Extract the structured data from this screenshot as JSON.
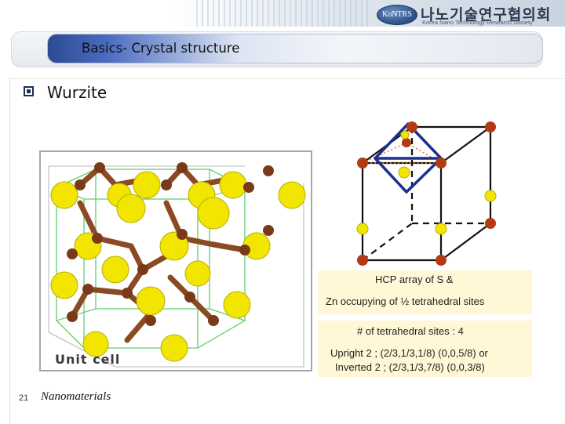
{
  "header": {
    "logo_abbr": "KoNTRS",
    "logo_korean": "나노기술연구협의회",
    "logo_english": "Korea Nano Technology Research Society"
  },
  "slide": {
    "title": "Basics- Crystal structure",
    "heading": "Wurzite",
    "unit_cell_label": "Unit cell",
    "info_hcp_line1": "HCP array of S  &",
    "info_hcp_line2": "Zn occupying of ½ tetrahedral sites",
    "info_tetra_count": "# of tetrahedral sites : 4",
    "info_upright": "Upright 2 ; (2/3,1/3,1/8) (0,0,5/8) or",
    "info_inverted": "Inverted 2 ; (2/3,1/3,7/8) (0,0,3/8)"
  },
  "footer": {
    "page_number": "21",
    "course": "Nanomaterials"
  },
  "colors": {
    "sulfur": "#f2e600",
    "zinc": "#7a3a1a",
    "bond": "#8a4a24",
    "cell_outline": "#5fd16a",
    "tetrahedron": "#1c2f8f",
    "info_background": "#fff7d6"
  }
}
